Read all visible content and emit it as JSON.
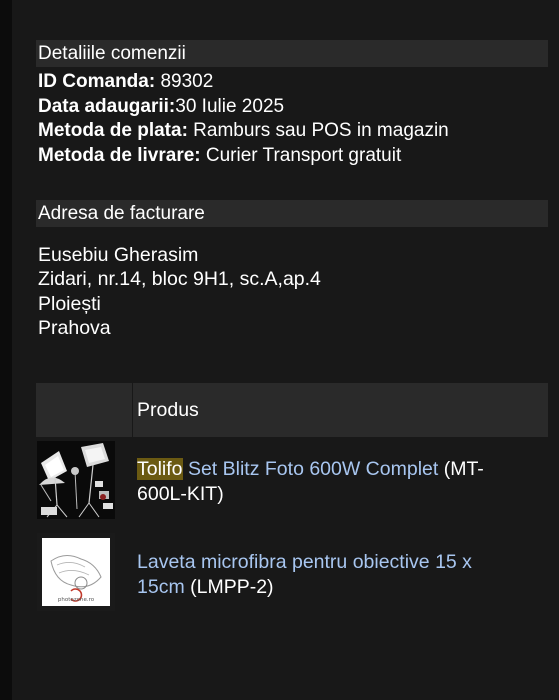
{
  "order_details": {
    "heading": "Detaliile comenzii",
    "lines": [
      {
        "label": "ID Comanda:",
        "value": " 89302"
      },
      {
        "label": "Data adaugarii:",
        "value": "30 Iulie 2025"
      },
      {
        "label": "Metoda de plata:",
        "value": " Ramburs sau POS in magazin"
      },
      {
        "label": "Metoda de livrare:",
        "value": " Curier Transport gratuit"
      }
    ]
  },
  "billing": {
    "heading": "Adresa de facturare",
    "lines": [
      "Eusebiu Gherasim",
      "Zidari, nr.14, bloc 9H1, sc.A,ap.4",
      "Ploiești",
      "Prahova"
    ]
  },
  "products": {
    "column_header": "Produs",
    "items": [
      {
        "brand": "Tolifo",
        "name": " Set Blitz Foto 600W Complet",
        "code": " (MT-600L-KIT)",
        "thumb_icon": "studio-flash-kit-image"
      },
      {
        "brand": "",
        "name": "Laveta microfibra pentru obiective 15 x 15cm",
        "code": " (LMPP-2)",
        "thumb_icon": "microfiber-cloth-image",
        "thumb_text": "photozone.ro"
      }
    ]
  },
  "colors": {
    "background": "#0c0c0c",
    "panel": "#181818",
    "header_bar": "#2a2a2a",
    "link": "#a8c6f0",
    "brand_highlight": "#6b5a12"
  }
}
